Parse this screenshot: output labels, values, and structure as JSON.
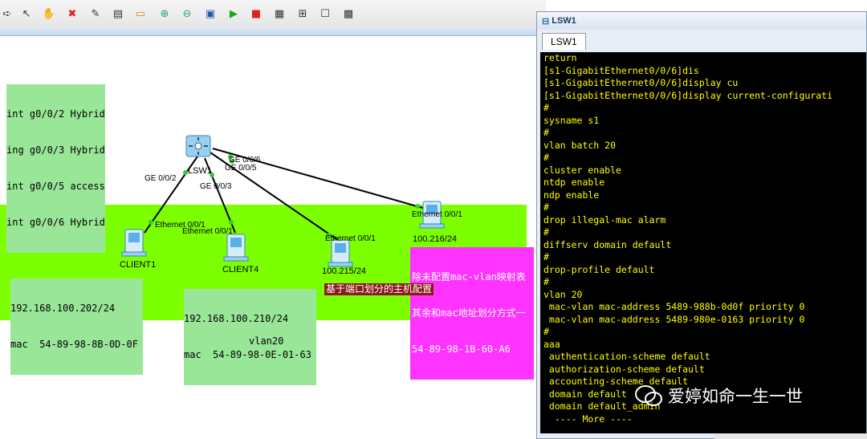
{
  "toolbar": {
    "buttons": [
      "arrow-icon",
      "pointer-icon",
      "hand-icon",
      "delete-icon",
      "edit-icon",
      "text-icon",
      "rectangle-icon",
      "zoom-in-icon",
      "zoom-out-icon",
      "fit-icon",
      "start-icon",
      "stop-icon",
      "capture-icon",
      "topology-icon",
      "window-icon",
      "terminal-icon"
    ]
  },
  "canvas": {
    "port_note": [
      "int g0/0/2 Hybrid",
      "ing g0/0/3 Hybrid",
      "int g0/0/5 access",
      "int g0/0/6 Hybrid"
    ],
    "switch": {
      "name": "LSW1",
      "ports": [
        "GE 0/0/2",
        "GE 0/0/3",
        "GE 0/0/5",
        "GE 0/0/6"
      ]
    },
    "devices": [
      {
        "name": "CLIENT1",
        "port": "Ethernet 0/0/1"
      },
      {
        "name": "CLIENT4",
        "port": "Ethernet 0/0/1"
      },
      {
        "name": "100.215/24",
        "port": "Ethernet 0/0/1"
      },
      {
        "name": "100.216/24",
        "port": "Ethernet 0/0/1"
      }
    ],
    "client1_info": [
      "192.168.100.202/24",
      "mac  54-89-98-8B-0D-0F"
    ],
    "client4_info": [
      "192.168.100.210/24",
      "mac  54-89-98-0E-01-63"
    ],
    "magenta_note": [
      "除未配置mac-vlan映射表",
      "其余和mac地址划分方式一",
      "54-89-98-1B-60-A6"
    ],
    "maroon_note": "基于端口划分的主机配置",
    "vlan_label": "vlan20"
  },
  "window": {
    "title": "LSW1",
    "tab": "LSW1",
    "terminal_lines": [
      "return",
      "[s1-GigabitEthernet0/0/6]dis",
      "[s1-GigabitEthernet0/0/6]display cu",
      "[s1-GigabitEthernet0/0/6]display current-configurati",
      "#",
      "sysname s1",
      "#",
      "vlan batch 20",
      "#",
      "cluster enable",
      "ntdp enable",
      "ndp enable",
      "#",
      "drop illegal-mac alarm",
      "#",
      "diffserv domain default",
      "#",
      "drop-profile default",
      "#",
      "vlan 20",
      " mac-vlan mac-address 5489-988b-0d0f priority 0",
      " mac-vlan mac-address 5489-980e-0163 priority 0",
      "#",
      "aaa",
      " authentication-scheme default",
      " authorization-scheme default",
      " accounting-scheme default",
      " domain default",
      " domain default_admin",
      "  ---- More ----"
    ]
  },
  "watermark": {
    "text": "爱婷如命一生一世",
    "icon": "wechat-icon"
  },
  "colors": {
    "green_area": "#7cff00",
    "note_green": "#99e699",
    "magenta": "#ff33ff",
    "maroon": "#8b1a1a",
    "terminal_text": "#ffff00"
  }
}
